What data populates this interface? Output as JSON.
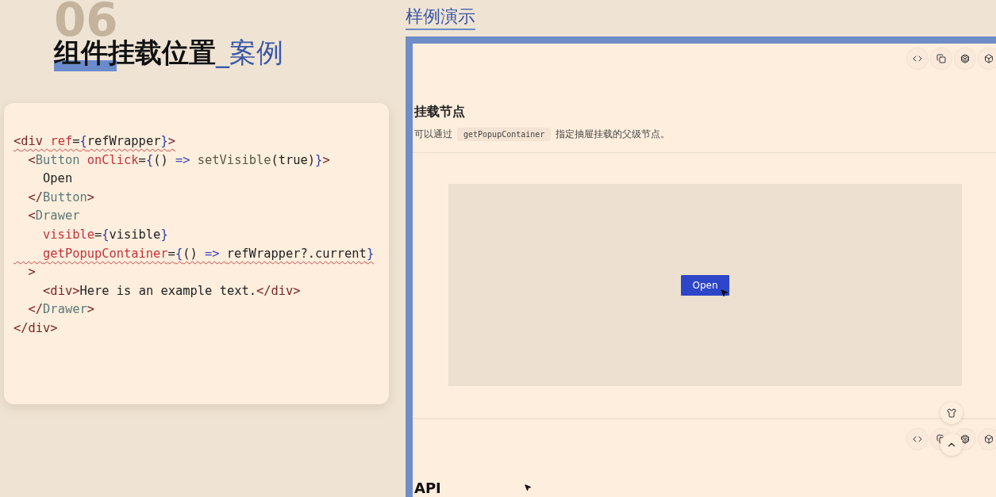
{
  "slide": {
    "number": "06",
    "title": "组件挂载位置",
    "title_suffix": "_案例"
  },
  "code": {
    "lines": [
      {
        "text": "<div ref={refWrapper}>",
        "squiggle": true
      },
      {
        "text": "  <Button onClick={() => setVisible(true)}>",
        "squiggle": false
      },
      {
        "text": "    Open",
        "squiggle": false
      },
      {
        "text": "  </Button>",
        "squiggle": false
      },
      {
        "text": "  <Drawer",
        "squiggle": false
      },
      {
        "text": "    visible={visible}",
        "squiggle": false
      },
      {
        "text": "    getPopupContainer={() => refWrapper?.current}",
        "squiggle": true
      },
      {
        "text": "  >",
        "squiggle": false
      },
      {
        "text": "    <div>Here is an example text.</div>",
        "squiggle": false
      },
      {
        "text": "  </Drawer>",
        "squiggle": false
      },
      {
        "text": "</div>",
        "squiggle": false
      }
    ]
  },
  "demo": {
    "heading": "样例演示",
    "section_title": "挂载节点",
    "description": {
      "before": "可以通过",
      "code": "getPopupContainer",
      "after": "指定抽屉挂载的父级节点。"
    },
    "open_button": "Open",
    "next_heading": "API"
  }
}
